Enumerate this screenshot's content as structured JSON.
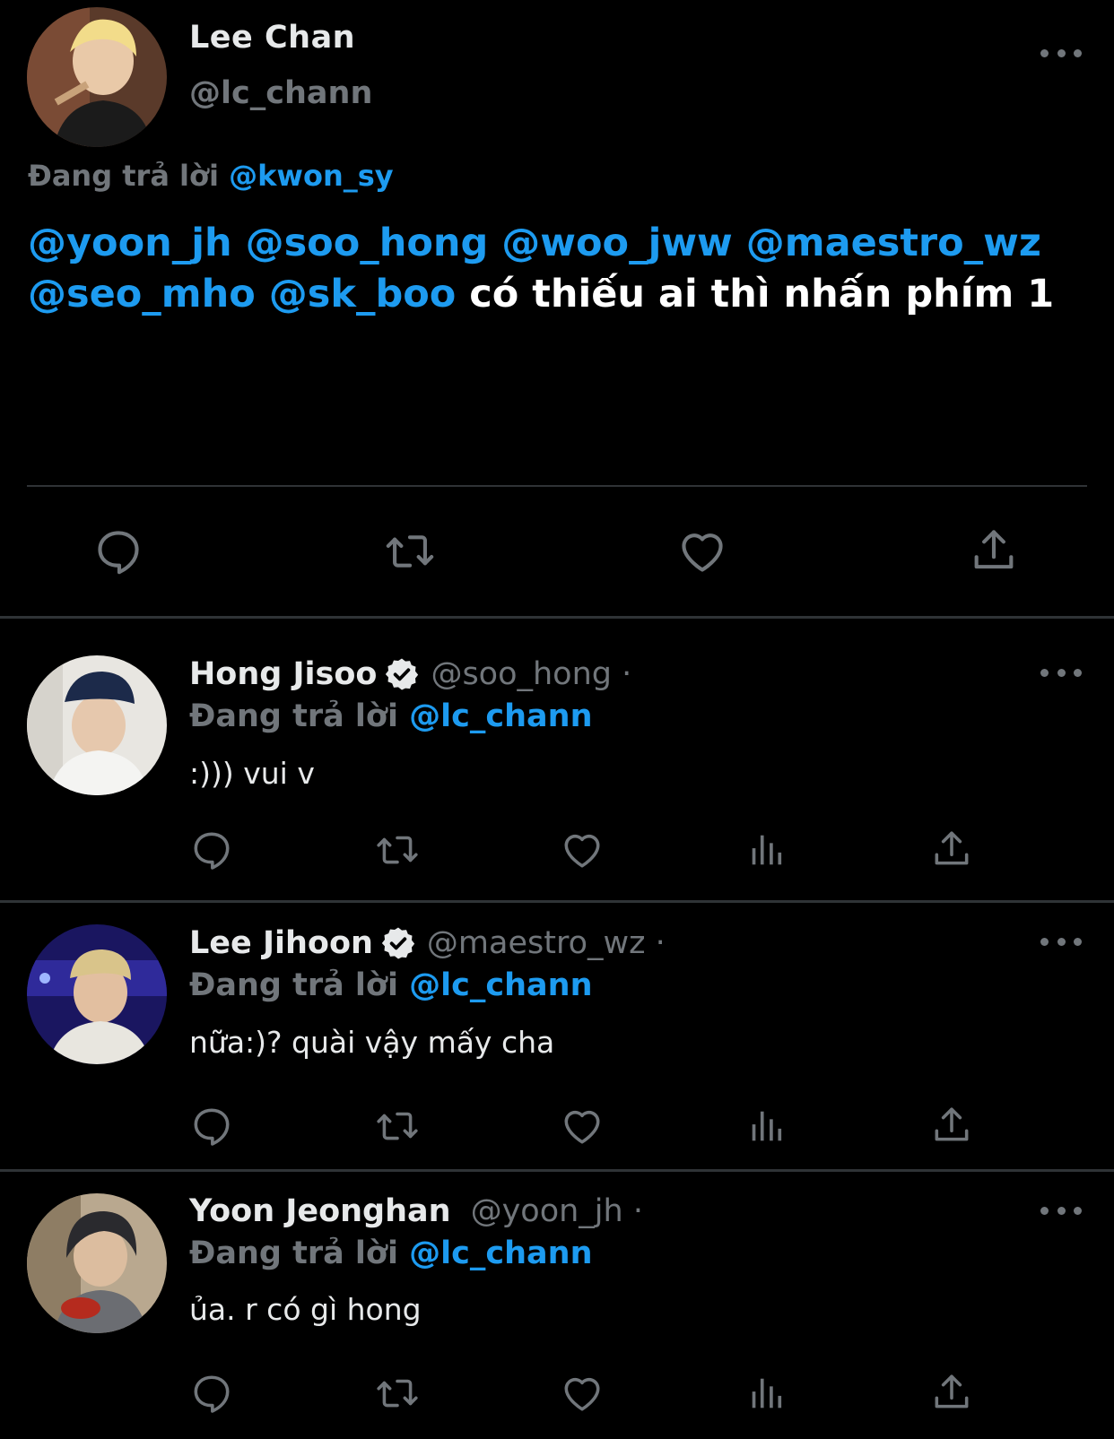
{
  "main_tweet": {
    "author_name": "Lee Chan",
    "author_handle": "@lc_chann",
    "replying_prefix": "Đang trả lời",
    "replying_to": "@kwon_sy",
    "mentions": [
      "@yoon_jh",
      "@soo_hong",
      "@woo_jww",
      "@maestro_wz",
      "@seo_mho",
      "@sk_boo"
    ],
    "text_suffix": "có thiếu ai thì nhấn phím 1",
    "actions": [
      "reply-icon",
      "retweet-icon",
      "like-icon",
      "share-icon"
    ]
  },
  "replies": [
    {
      "author_name": "Hong Jisoo",
      "verified": true,
      "author_handle": "@soo_hong ·",
      "replying_prefix": "Đang trả lời",
      "replying_to": "@lc_chann",
      "text": ":))) vui v"
    },
    {
      "author_name": "Lee Jihoon",
      "verified": true,
      "author_handle": "@maestro_wz ·",
      "replying_prefix": "Đang trả lời",
      "replying_to": "@lc_chann",
      "text": "nữa:)? quài vậy mấy cha"
    },
    {
      "author_name": "Yoon Jeonghan",
      "verified": false,
      "author_handle": "@yoon_jh ·",
      "replying_prefix": "Đang trả lời",
      "replying_to": "@lc_chann",
      "text": "ủa. r có gì hong"
    }
  ],
  "reply_actions": [
    "reply-icon",
    "retweet-icon",
    "like-icon",
    "views-icon",
    "share-icon"
  ],
  "colors": {
    "background": "#000000",
    "link": "#1d9bf0",
    "secondary": "#71767b",
    "text": "#e7e9ea",
    "divider": "#2f3336"
  }
}
